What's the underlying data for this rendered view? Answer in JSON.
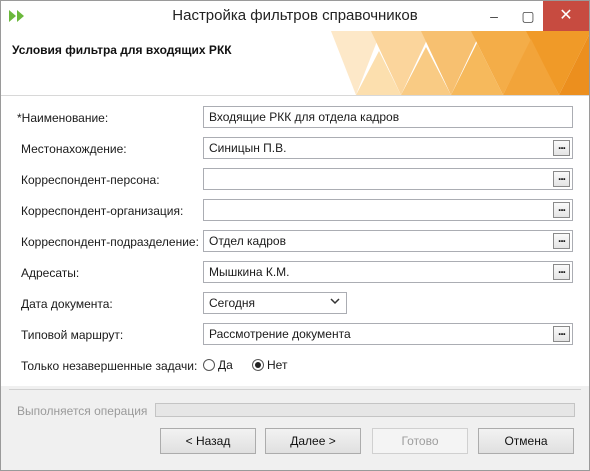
{
  "window": {
    "title": "Настройка фильтров справочников",
    "close_glyph": "✕",
    "max_glyph": "▢",
    "min_glyph": "–",
    "app_icon": "double-arrow-icon"
  },
  "banner": {
    "title": "Условия фильтра для входящих РКК"
  },
  "form": {
    "name": {
      "label": "*Наименование:",
      "value": "Входящие РКК для отдела кадров"
    },
    "location": {
      "label": "Местонахождение:",
      "value": "Синицын П.В."
    },
    "person": {
      "label": "Корреспондент-персона:",
      "value": ""
    },
    "org": {
      "label": "Корреспондент-организация:",
      "value": ""
    },
    "dept": {
      "label": "Корреспондент-подразделение:",
      "value": "Отдел кадров"
    },
    "addressees": {
      "label": "Адресаты:",
      "value": "Мышкина К.М."
    },
    "doc_date": {
      "label": "Дата документа:",
      "value": "Сегодня"
    },
    "route": {
      "label": "Типовой маршрут:",
      "value": "Рассмотрение документа"
    },
    "unfinished": {
      "label": "Только незавершенные задачи:",
      "yes": "Да",
      "no": "Нет",
      "selected": "Нет"
    }
  },
  "lookup_glyph": "...",
  "progress": {
    "label": "Выполняется операция",
    "fraction": 0
  },
  "buttons": {
    "back": "< Назад",
    "next": "Далее >",
    "done": "Готово",
    "cancel": "Отмена"
  },
  "colors": {
    "banner_orange": "#f0a030",
    "close_red": "#c74b40",
    "app_icon_green": "#6bb83c"
  }
}
